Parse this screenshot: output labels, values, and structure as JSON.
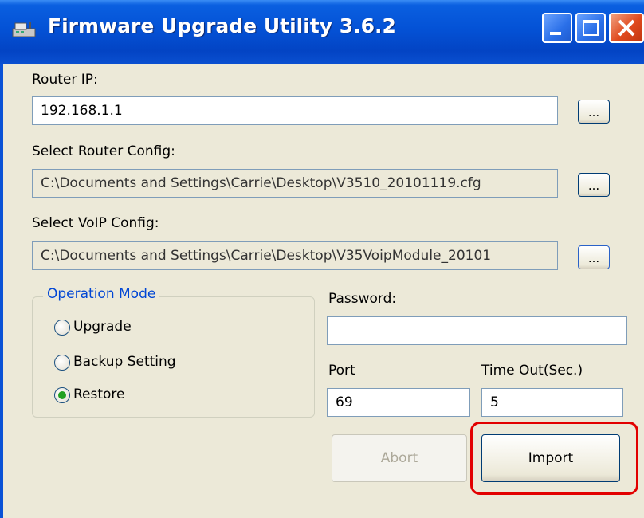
{
  "window": {
    "title": "Firmware Upgrade Utility 3.6.2"
  },
  "router_ip": {
    "label": "Router IP:",
    "value": "192.168.1.1",
    "browse_label": "..."
  },
  "router_config": {
    "label": "Select Router Config:",
    "value": "C:\\Documents and Settings\\Carrie\\Desktop\\V3510_20101119.cfg",
    "browse_label": "..."
  },
  "voip_config": {
    "label": "Select VoIP Config:",
    "value": "C:\\Documents and Settings\\Carrie\\Desktop\\V35VoipModule_20101",
    "browse_label": "..."
  },
  "operation_mode": {
    "title": "Operation Mode",
    "options": [
      {
        "label": "Upgrade",
        "selected": false
      },
      {
        "label": "Backup Setting",
        "selected": false
      },
      {
        "label": "Restore",
        "selected": true
      }
    ]
  },
  "password": {
    "label": "Password:",
    "value": ""
  },
  "port": {
    "label": "Port",
    "value": "69"
  },
  "timeout": {
    "label": "Time Out(Sec.)",
    "value": "5"
  },
  "buttons": {
    "abort": "Abort",
    "import": "Import"
  },
  "colors": {
    "titlebar": "#0452d6",
    "group_title": "#0046d5",
    "highlight": "#e20000",
    "radio_dot": "#21a121"
  }
}
